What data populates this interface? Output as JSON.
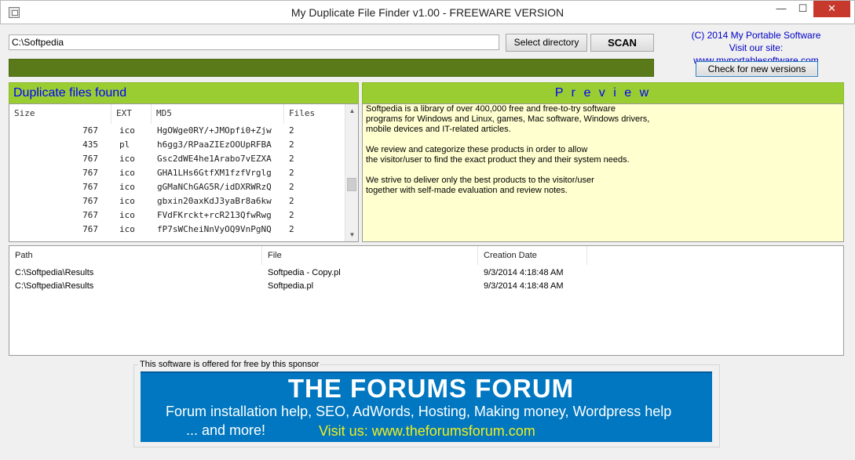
{
  "window": {
    "title": "My Duplicate File Finder v1.00 - FREEWARE VERSION",
    "min_glyph": "—",
    "max_glyph": "☐",
    "close_glyph": "✕"
  },
  "toolbar": {
    "directory_value": "C:\\Softpedia",
    "select_directory_label": "Select directory",
    "scan_label": "SCAN",
    "check_versions_label": "Check for new versions"
  },
  "info": {
    "copyright": "(C) 2014 My Portable Software",
    "visit": "Visit our site: www.myportablesoftware.com"
  },
  "progress": {
    "value": 1.0
  },
  "duplicates": {
    "title": "Duplicate files found",
    "columns": [
      "Size",
      "EXT",
      "MD5",
      "Files"
    ],
    "rows": [
      {
        "size": "767",
        "ext": "ico",
        "md5": "HgOWge0RY/+JMOpfi0+Zjw",
        "files": "2"
      },
      {
        "size": "435",
        "ext": "pl",
        "md5": "h6gg3/RPaaZIEzOOUpRFBA",
        "files": "2"
      },
      {
        "size": "767",
        "ext": "ico",
        "md5": "Gsc2dWE4he1Arabo7vEZXA",
        "files": "2"
      },
      {
        "size": "767",
        "ext": "ico",
        "md5": "GHA1LHs6GtfXM1fzfVrglg",
        "files": "2"
      },
      {
        "size": "767",
        "ext": "ico",
        "md5": "gGMaNChGAG5R/idDXRWRzQ",
        "files": "2"
      },
      {
        "size": "767",
        "ext": "ico",
        "md5": "gbxin20axKdJ3yaBr8a6kw",
        "files": "2"
      },
      {
        "size": "767",
        "ext": "ico",
        "md5": "FVdFKrckt+rcR213QfwRwg",
        "files": "2"
      },
      {
        "size": "767",
        "ext": "ico",
        "md5": "fP7sWCheiNnVyOQ9VnPgNQ",
        "files": "2"
      }
    ]
  },
  "preview": {
    "title": "P r e v i e w",
    "lines": [
      "Softpedia is a library of over 400,000 free and free-to-try software",
      "programs for Windows and Linux, games, Mac software, Windows drivers,",
      "mobile devices and IT-related articles.",
      "",
      "We review and categorize these products in order to allow",
      "the visitor/user to find the exact product they and their system needs.",
      "",
      "We strive to deliver only the best products to the visitor/user",
      "together with self-made evaluation and review notes."
    ]
  },
  "files": {
    "columns": [
      "Path",
      "File",
      "Creation Date"
    ],
    "rows": [
      {
        "path": "C:\\Softpedia\\Results",
        "file": "Softpedia - Copy.pl",
        "date": "9/3/2014 4:18:48 AM"
      },
      {
        "path": "C:\\Softpedia\\Results",
        "file": "Softpedia.pl",
        "date": "9/3/2014 4:18:48 AM"
      }
    ]
  },
  "sponsor": {
    "legend": "This software is offered for free by this sponsor",
    "banner_title": "THE FORUMS FORUM",
    "banner_line1": "Forum installation help, SEO, AdWords, Hosting, Making money, Wordpress help",
    "banner_line2": "... and more!",
    "banner_line3": "Visit us: www.theforumsforum.com"
  },
  "scroll": {
    "up_glyph": "▲",
    "down_glyph": "▼"
  }
}
